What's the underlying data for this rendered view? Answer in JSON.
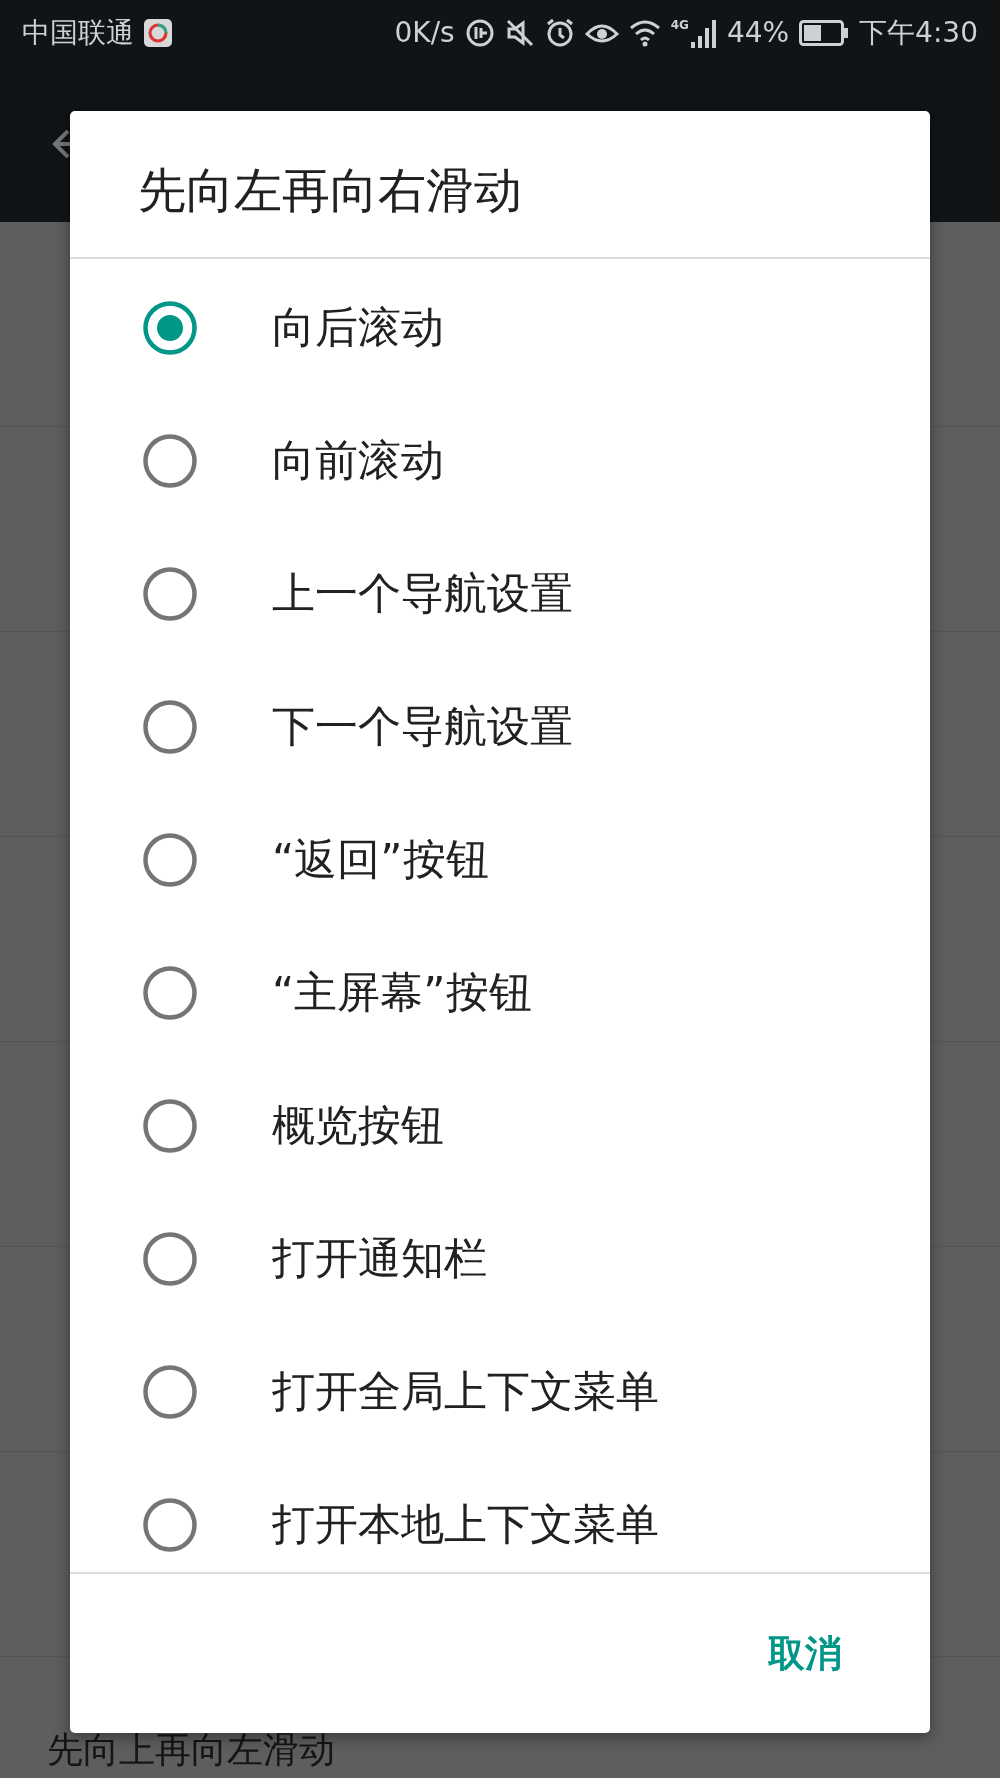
{
  "status_bar": {
    "carrier": "中国联通",
    "speed": "0K/s",
    "network": "4G",
    "battery": "44%",
    "time": "下午4:30"
  },
  "background_list": [
    {
      "kind": "covered"
    },
    {
      "kind": "covered"
    },
    {
      "kind": "covered"
    },
    {
      "kind": "covered"
    },
    {
      "kind": "covered"
    },
    {
      "kind": "covered"
    },
    {
      "kind": "covered"
    },
    {
      "kind": "visible",
      "title": "先向上再向左滑动"
    }
  ],
  "dialog": {
    "title": "先向左再向右滑动",
    "options": [
      {
        "label": "向后滚动",
        "selected": true
      },
      {
        "label": "向前滚动",
        "selected": false
      },
      {
        "label": "上一个导航设置",
        "selected": false
      },
      {
        "label": "下一个导航设置",
        "selected": false
      },
      {
        "label": "“返回”按钮",
        "selected": false
      },
      {
        "label": "“主屏幕”按钮",
        "selected": false
      },
      {
        "label": "概览按钮",
        "selected": false
      },
      {
        "label": "打开通知栏",
        "selected": false
      },
      {
        "label": "打开全局上下文菜单",
        "selected": false
      },
      {
        "label": "打开本地上下文菜单",
        "selected": false
      }
    ],
    "cancel": "取消"
  }
}
